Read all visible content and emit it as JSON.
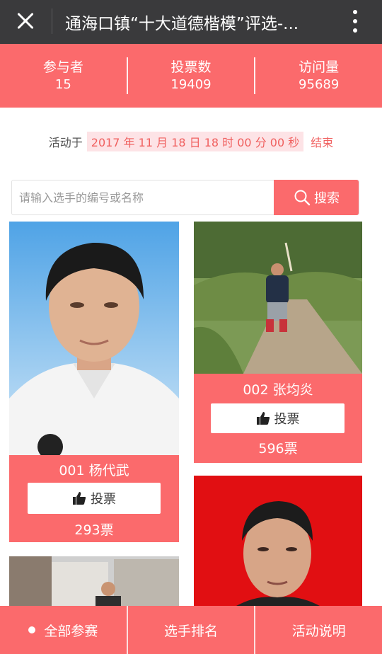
{
  "header": {
    "title": "通海口镇“十大道德楷模”评选-..."
  },
  "stats": [
    {
      "label": "参与者",
      "value": "15"
    },
    {
      "label": "投票数",
      "value": "19409"
    },
    {
      "label": "访问量",
      "value": "95689"
    }
  ],
  "activity": {
    "prefix": "活动于",
    "end_time": "2017 年 11 月 18 日 18 时 00 分 00 秒",
    "suffix": "结束"
  },
  "search": {
    "placeholder": "请输入选手的编号或名称",
    "button_label": "搜索"
  },
  "candidates": [
    {
      "number_name": "001 杨代武",
      "vote_label": "投票",
      "votes": "293票"
    },
    {
      "number_name": "002 张均炎",
      "vote_label": "投票",
      "votes": "596票"
    }
  ],
  "bottom_nav": [
    {
      "label": "全部参赛"
    },
    {
      "label": "选手排名"
    },
    {
      "label": "活动说明"
    }
  ],
  "colors": {
    "accent": "#fb6a6c",
    "header_bg": "#3a3a3c",
    "time_highlight_bg": "#fde3e6"
  }
}
